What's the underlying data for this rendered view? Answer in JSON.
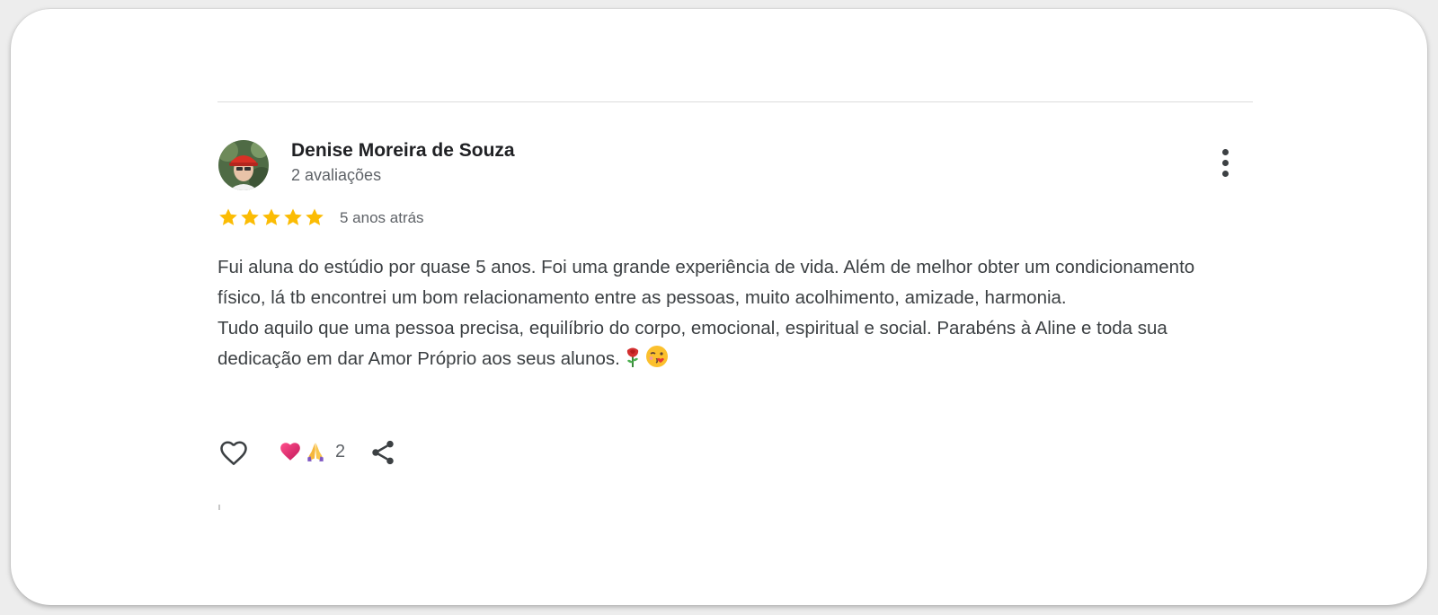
{
  "review": {
    "reviewer_name": "Denise Moreira de Souza",
    "review_count": "2 avaliações",
    "rating": 5,
    "rating_max": 5,
    "date": "5 anos atrás",
    "text_paragraph_1": "Fui aluna do estúdio por quase 5 anos. Foi uma grande experiência de vida. Além de melhor obter um condicionamento físico, lá tb encontrei um bom relacionamento entre as pessoas, muito acolhimento, amizade, harmonia.",
    "text_paragraph_2": "Tudo aquilo que uma pessoa precisa, equilíbrio do corpo, emocional, espiritual e social. Parabéns à Aline e toda sua dedicação em dar Amor Próprio aos seus alunos.",
    "text_emojis": [
      "rose-icon",
      "kiss-face-icon"
    ]
  },
  "actions": {
    "like_icon": "heart-outline-icon",
    "reactions": [
      "heart-icon",
      "praying-hands-icon"
    ],
    "reaction_count": "2",
    "share_icon": "share-icon",
    "menu_icon": "more-vert-icon"
  },
  "colors": {
    "star": "#fbbc04",
    "name_text": "#202124",
    "secondary_text": "#5f6368",
    "body_text": "#3c4043"
  }
}
